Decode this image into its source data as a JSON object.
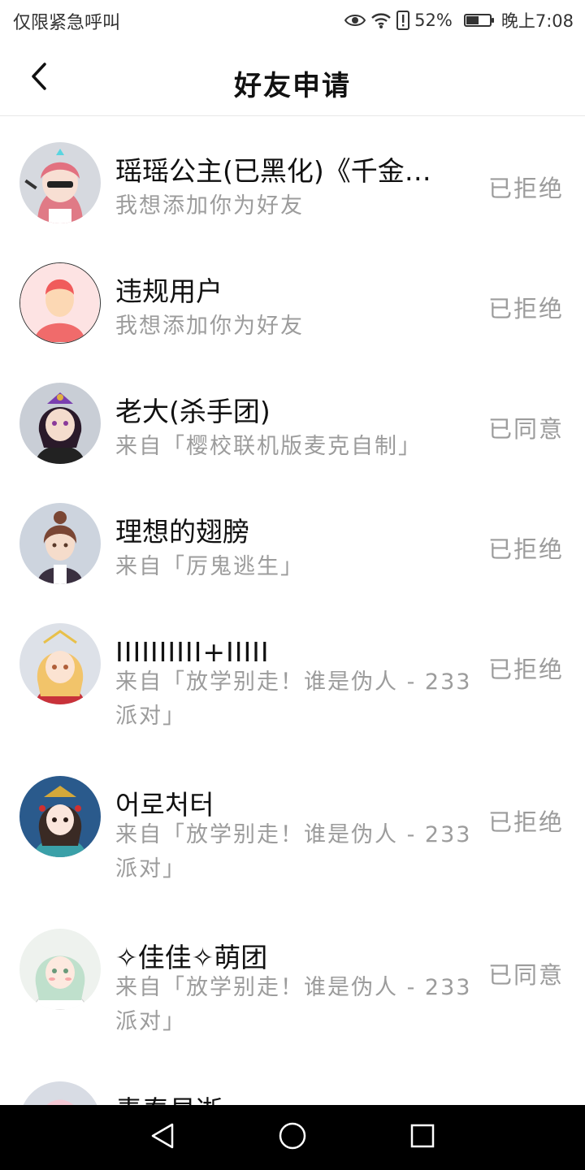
{
  "status_bar": {
    "left_text": "仅限紧急呼叫",
    "battery_text": "52%",
    "battery_level": 0.52,
    "time": "晚上7:08",
    "icons": [
      "eye-icon",
      "wifi-icon",
      "alert-icon",
      "battery-icon"
    ]
  },
  "header": {
    "title": "好友申请",
    "back_icon": "chevron-left-icon"
  },
  "requests": [
    {
      "name": "瑶瑶公主(已黑化)《千金…",
      "message": "我想添加你为好友",
      "status": "已拒绝",
      "avatar_color": "#e8c4cc"
    },
    {
      "name": "违规用户",
      "message": "我想添加你为好友",
      "status": "已拒绝",
      "avatar_color": "#fde0e0"
    },
    {
      "name": "老大(杀手团)",
      "message": "来自「樱校联机版麦克自制」",
      "status": "已同意",
      "avatar_color": "#cfd3da"
    },
    {
      "name": "理想的翅膀",
      "message": "来自「厉鬼逃生」",
      "status": "已拒绝",
      "avatar_color": "#cfd6e0"
    },
    {
      "name": "IIIIIIIIII+IIIII",
      "message": "来自「放学别走！谁是伪人 - 233派对」",
      "status": "已拒绝",
      "avatar_color": "#dde2ea"
    },
    {
      "name": "어로처터",
      "message": "来自「放学别走！谁是伪人 - 233派对」",
      "status": "已拒绝",
      "avatar_color": "#2a5a8c"
    },
    {
      "name": "✧佳佳✧萌团",
      "message": "来自「放学别走！谁是伪人 - 233派对」",
      "status": "已同意",
      "avatar_color": "#e6eee8"
    },
    {
      "name": "青春易逝",
      "message": "",
      "status": "",
      "avatar_color": "#f4c8d4"
    }
  ],
  "navbar": {
    "icons": [
      "back-triangle-icon",
      "home-circle-icon",
      "recents-square-icon"
    ]
  }
}
